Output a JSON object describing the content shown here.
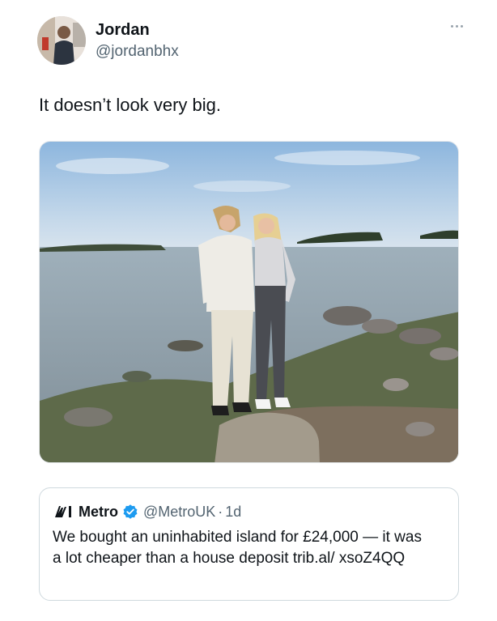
{
  "author": {
    "display_name": "Jordan",
    "handle": "@jordanbhx",
    "avatar_icon": "profile-photo"
  },
  "tweet": {
    "text": "It doesn’t look very big.",
    "more_icon": "ellipsis-icon"
  },
  "media": {
    "kind": "photo",
    "description_icon": "couple-on-lake-shore-photo"
  },
  "quote": {
    "display_name": "Metro",
    "verified": true,
    "handle": "@MetroUK",
    "separator": "·",
    "time": "1d",
    "text": "We bought an uninhabited island for £24,000 — it was a lot cheaper than a house deposit trib.al/ xsoZ4QQ",
    "verified_color": "#1d9bf0"
  },
  "colors": {
    "text_primary": "#0f1419",
    "text_secondary": "#536471",
    "border": "#cfd9de"
  }
}
